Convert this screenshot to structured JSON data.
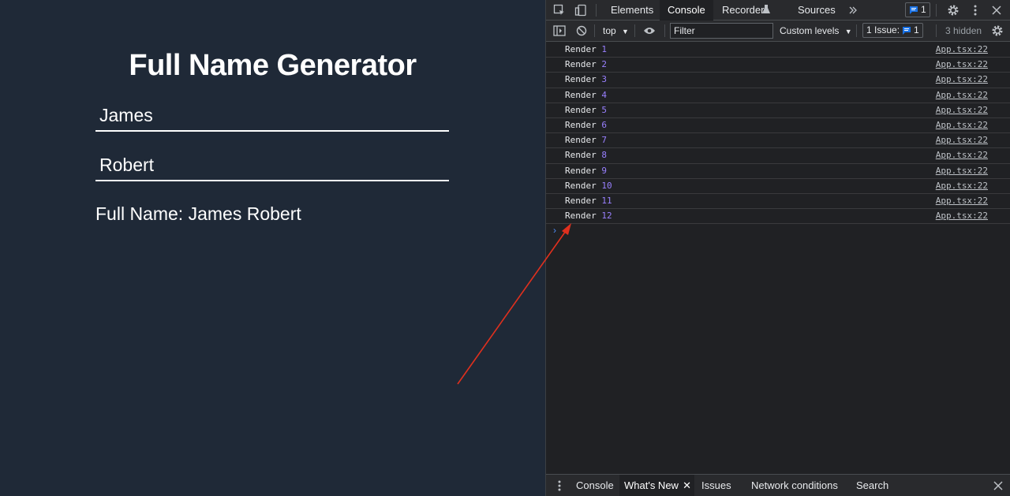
{
  "app": {
    "title": "Full Name Generator",
    "first_name_value": "James",
    "last_name_value": "Robert",
    "full_name_text": "Full Name: James Robert"
  },
  "devtools": {
    "tabs": [
      "Elements",
      "Console",
      "Recorder",
      "Sources"
    ],
    "active_tab": "Console",
    "more_tabs_icon": "chevron-double-right-icon",
    "messages_badge_count": "1",
    "toolbar": {
      "context": "top",
      "filter_placeholder": "Filter",
      "levels": "Custom levels",
      "issues_label": "1 Issue:",
      "issues_count": "1",
      "hidden_count": "3 hidden"
    },
    "logs": [
      {
        "text": "Render",
        "num": "1",
        "source": "App.tsx:22"
      },
      {
        "text": "Render",
        "num": "2",
        "source": "App.tsx:22"
      },
      {
        "text": "Render",
        "num": "3",
        "source": "App.tsx:22"
      },
      {
        "text": "Render",
        "num": "4",
        "source": "App.tsx:22"
      },
      {
        "text": "Render",
        "num": "5",
        "source": "App.tsx:22"
      },
      {
        "text": "Render",
        "num": "6",
        "source": "App.tsx:22"
      },
      {
        "text": "Render",
        "num": "7",
        "source": "App.tsx:22"
      },
      {
        "text": "Render",
        "num": "8",
        "source": "App.tsx:22"
      },
      {
        "text": "Render",
        "num": "9",
        "source": "App.tsx:22"
      },
      {
        "text": "Render",
        "num": "10",
        "source": "App.tsx:22"
      },
      {
        "text": "Render",
        "num": "11",
        "source": "App.tsx:22"
      },
      {
        "text": "Render",
        "num": "12",
        "source": "App.tsx:22"
      }
    ],
    "drawer_tabs": [
      "Console",
      "What's New",
      "Issues",
      "Network conditions",
      "Search"
    ],
    "drawer_active": "What's New"
  },
  "colors": {
    "app_bg": "#1f2937",
    "devtools_bg": "#202124",
    "log_number": "#9980ff",
    "accent_blue": "#1a73e8",
    "annotation_arrow": "#e0301e"
  }
}
